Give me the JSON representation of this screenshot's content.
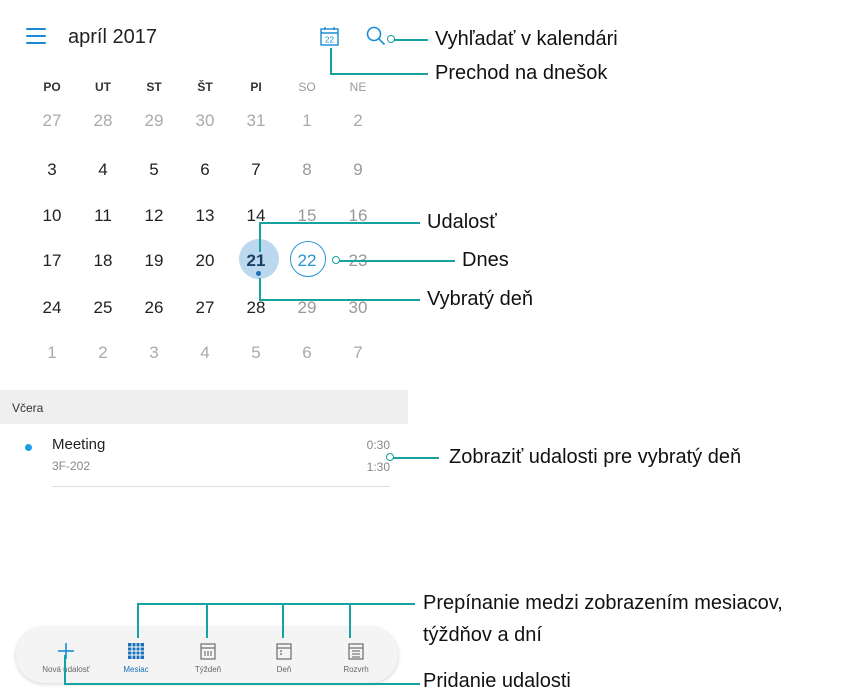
{
  "header": {
    "title": "apríl 2017",
    "today_icon_day": "22"
  },
  "weekdays": [
    "PO",
    "UT",
    "ST",
    "ŠT",
    "PI",
    "SO",
    "NE"
  ],
  "weeks": [
    [
      "27",
      "28",
      "29",
      "30",
      "31",
      "1",
      "2"
    ],
    [
      "3",
      "4",
      "5",
      "6",
      "7",
      "8",
      "9"
    ],
    [
      "10",
      "11",
      "12",
      "13",
      "14",
      "15",
      "16"
    ],
    [
      "17",
      "18",
      "19",
      "20",
      "21",
      "22",
      "23"
    ],
    [
      "24",
      "25",
      "26",
      "27",
      "28",
      "29",
      "30"
    ],
    [
      "1",
      "2",
      "3",
      "4",
      "5",
      "6",
      "7"
    ]
  ],
  "section_label": "Včera",
  "event": {
    "title": "Meeting",
    "location": "3F-202",
    "start": "0:30",
    "end": "1:30"
  },
  "bottom_nav": [
    {
      "label": "Nová udalosť",
      "icon": "plus-icon"
    },
    {
      "label": "Mesiac",
      "icon": "month-grid-icon"
    },
    {
      "label": "Týždeň",
      "icon": "week-icon"
    },
    {
      "label": "Deň",
      "icon": "day-icon"
    },
    {
      "label": "Rozvrh",
      "icon": "schedule-icon"
    }
  ],
  "annotations": {
    "search": "Vyhľadať v kalendári",
    "go_today": "Prechod na dnešok",
    "event": "Udalosť",
    "today": "Dnes",
    "selected_day": "Vybratý deň",
    "show_events": "Zobraziť udalosti pre vybratý deň",
    "switch_line1": "Prepínanie medzi zobrazením mesiacov,",
    "switch_line2": "týždňov a dní",
    "add_event": "Pridanie udalosti"
  },
  "colors": {
    "accent": "#1a8bd6",
    "annotation_line": "#17a2a0",
    "selected_bg": "#bcd8ee"
  }
}
